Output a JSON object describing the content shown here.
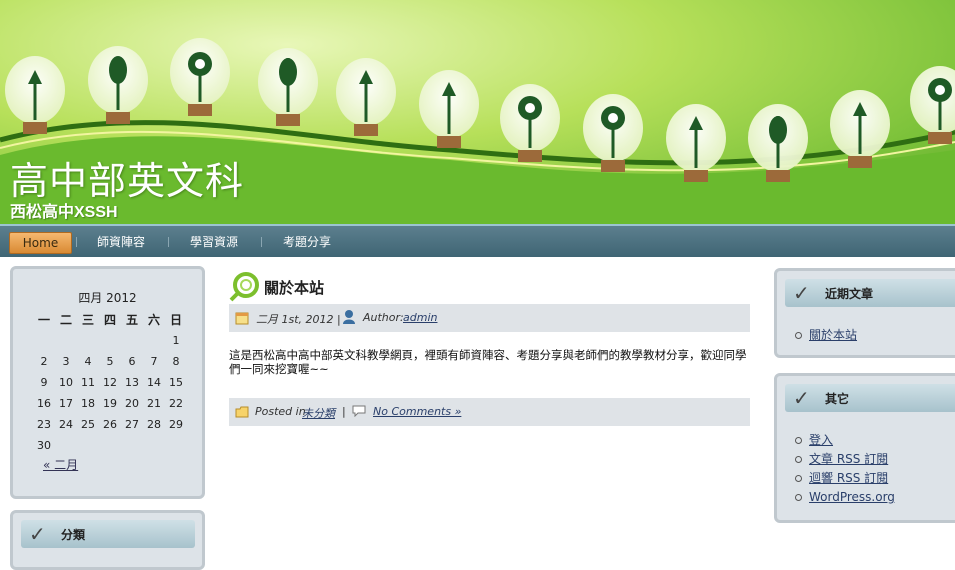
{
  "site": {
    "title": "高中部英文科",
    "description": "西松高中XSSH"
  },
  "nav": {
    "items": [
      {
        "label": "Home",
        "active": true
      },
      {
        "label": "師資陣容"
      },
      {
        "label": "學習資源"
      },
      {
        "label": "考題分享"
      }
    ]
  },
  "calendar": {
    "caption": "四月 2012",
    "weekdays": [
      "一",
      "二",
      "三",
      "四",
      "五",
      "六",
      "日"
    ],
    "weeks": [
      [
        "",
        "",
        "",
        "",
        "",
        "",
        "1"
      ],
      [
        "2",
        "3",
        "4",
        "5",
        "6",
        "7",
        "8"
      ],
      [
        "9",
        "10",
        "11",
        "12",
        "13",
        "14",
        "15"
      ],
      [
        "16",
        "17",
        "18",
        "19",
        "20",
        "21",
        "22"
      ],
      [
        "23",
        "24",
        "25",
        "26",
        "27",
        "28",
        "29"
      ],
      [
        "30",
        "",
        "",
        "",
        "",
        "",
        ""
      ]
    ],
    "prev_link": "« 二月"
  },
  "categories_widget": {
    "title": "分類"
  },
  "recent_posts_widget": {
    "title": "近期文章",
    "items": [
      "關於本站"
    ]
  },
  "other_widget": {
    "title": "其它",
    "items": [
      "登入",
      "文章 RSS 訂閱",
      "迴響 RSS 訂閱",
      "WordPress.org"
    ]
  },
  "post": {
    "title": "關於本站",
    "date": "二月 1st, 2012 |",
    "author_label": "Author:",
    "author": "admin",
    "body": "這是西松高中高中部英文科教學網頁，裡頭有師資陣容、考題分享與老師們的教學教材分享，歡迎同學們一同來挖寶喔~~",
    "posted_in_label": "Posted in",
    "category": "未分類",
    "separator": "|",
    "comments": "No Comments »"
  },
  "colors": {
    "nav_bg": "#4d7382",
    "home_button": "#e39a44",
    "header_green": "#7cc23a",
    "box_bg": "#dde3e8"
  }
}
